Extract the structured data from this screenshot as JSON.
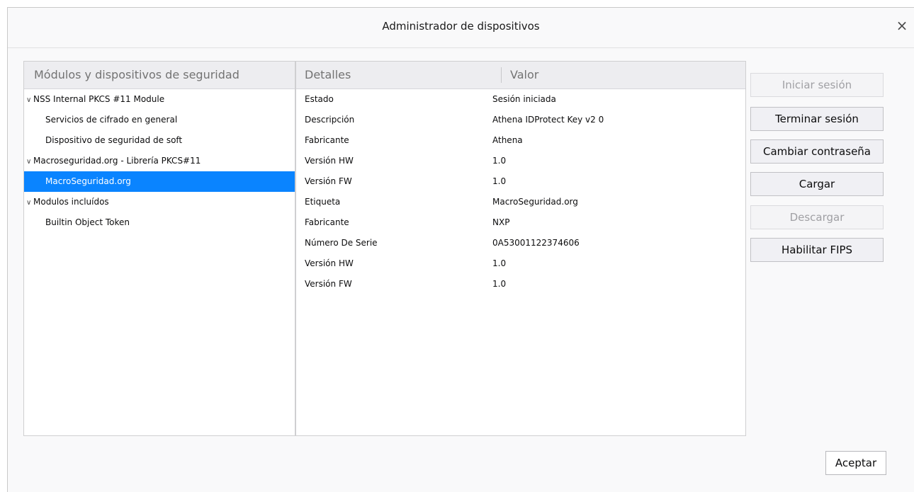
{
  "window": {
    "title": "Administrador de dispositivos",
    "close_icon": "×"
  },
  "tree": {
    "header": "Módulos y dispositivos de seguridad",
    "expand_icon": "∨",
    "items": [
      {
        "label": "NSS Internal PKCS #11 Module",
        "type": "module"
      },
      {
        "label": "Servicios de cifrado en general",
        "type": "device"
      },
      {
        "label": "Dispositivo de seguridad de soft",
        "type": "device"
      },
      {
        "label": "Macroseguridad.org - Librería PKCS#11",
        "type": "module"
      },
      {
        "label": "MacroSeguridad.org",
        "type": "device",
        "selected": true
      },
      {
        "label": "Modulos incluídos",
        "type": "module"
      },
      {
        "label": "Builtin Object Token",
        "type": "device"
      }
    ]
  },
  "details": {
    "col_details": "Detalles",
    "col_value": "Valor",
    "rows": [
      {
        "name": "Estado",
        "value": "Sesión iniciada"
      },
      {
        "name": "Descripción",
        "value": "Athena IDProtect Key v2 0"
      },
      {
        "name": "Fabricante",
        "value": "Athena"
      },
      {
        "name": "Versión HW",
        "value": "1.0"
      },
      {
        "name": "Versión FW",
        "value": "1.0"
      },
      {
        "name": "Etiqueta",
        "value": "MacroSeguridad.org"
      },
      {
        "name": "Fabricante",
        "value": "NXP"
      },
      {
        "name": "Número De Serie",
        "value": "0A53001122374606"
      },
      {
        "name": "Versión HW",
        "value": "1.0"
      },
      {
        "name": "Versión FW",
        "value": "1.0"
      }
    ]
  },
  "buttons": {
    "login": "Iniciar sesión",
    "logout": "Terminar sesión",
    "change_password": "Cambiar contraseña",
    "load": "Cargar",
    "unload": "Descargar",
    "enable_fips": "Habilitar FIPS",
    "ok": "Aceptar"
  },
  "colors": {
    "selection": "#0a84ff",
    "header_bg": "#ededf0"
  }
}
